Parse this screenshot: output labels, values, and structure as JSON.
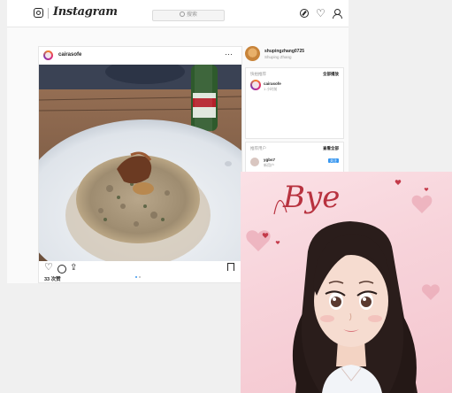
{
  "topbar": {
    "logo_text": "Instagram",
    "search_placeholder": "搜索",
    "icons": [
      "instagram-glyph-icon",
      "compass-icon",
      "heart-icon",
      "profile-icon"
    ]
  },
  "post": {
    "username": "cairasofe",
    "likes_text": "33 次赞",
    "carousel": {
      "total": 2,
      "current": 1
    }
  },
  "sidebar": {
    "profile_name": "shupingzhang0725",
    "profile_subtitle": "Shuping Zhang",
    "stories_title": "快拍推荐",
    "stories_link": "全部播放",
    "story_name": "cairasofe",
    "story_time": "1 小时前",
    "suggestions_title": "推荐用户",
    "suggestions_link": "查看全部",
    "suggestion_name": "ygbs7",
    "suggestion_sub": "新用户",
    "follow_label": "关注"
  },
  "overlay": {
    "handwriting": "Bye"
  },
  "colors": {
    "accent_blue": "#3897f0",
    "overlay_pink": "#f7d3da"
  }
}
